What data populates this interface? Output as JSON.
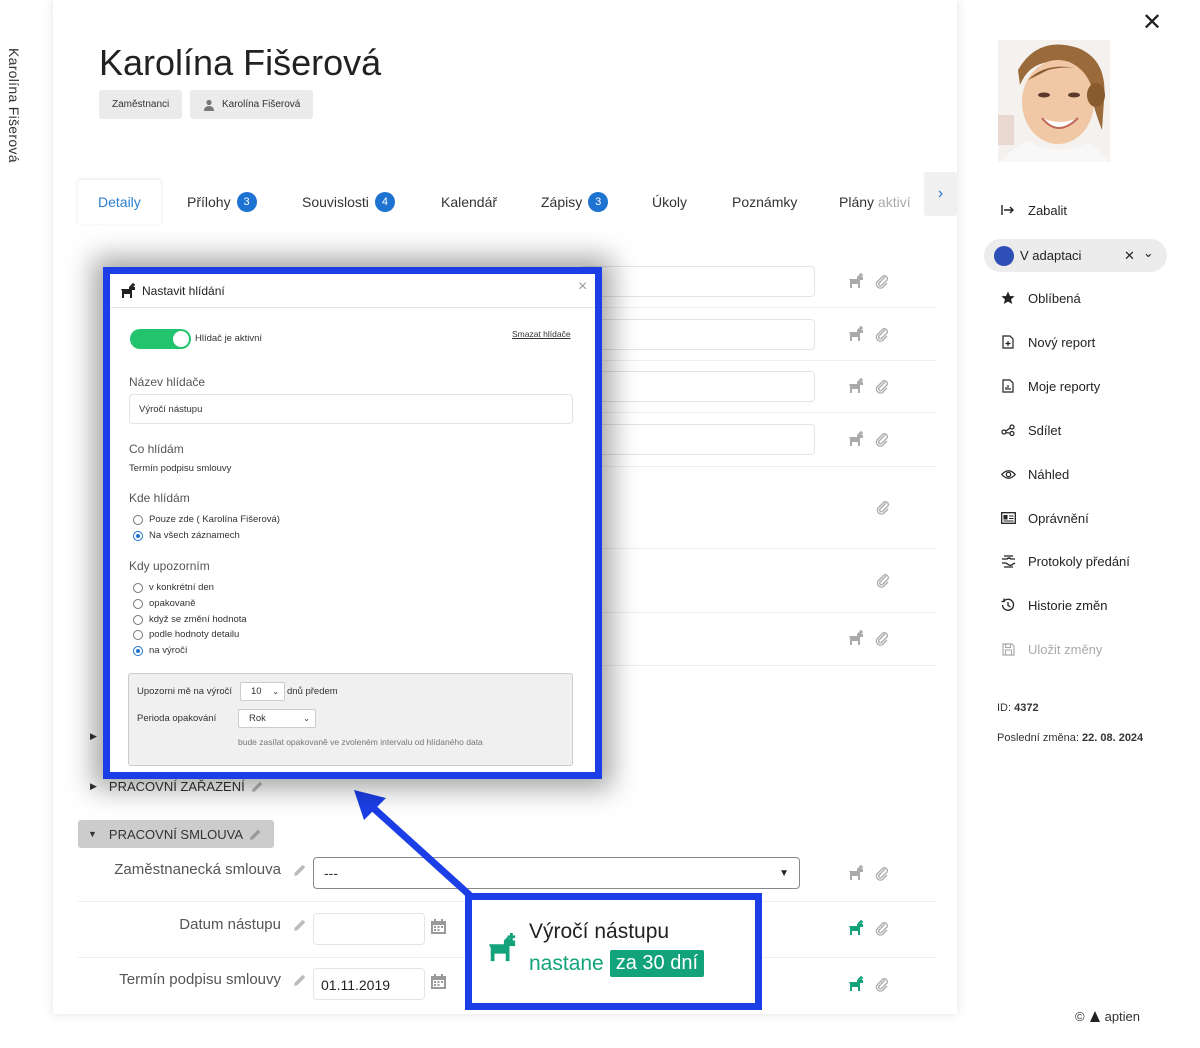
{
  "side_name": "Karolína Fišerová",
  "title": "Karolína Fišerová",
  "breadcrumbs": [
    "Zaměstnanci",
    "Karolína Fišerová"
  ],
  "tabs": [
    {
      "label": "Detaily",
      "badge": ""
    },
    {
      "label": "Přílohy",
      "badge": "3"
    },
    {
      "label": "Souvislosti",
      "badge": "4"
    },
    {
      "label": "Kalendář",
      "badge": ""
    },
    {
      "label": "Zápisy",
      "badge": "3"
    },
    {
      "label": "Úkoly",
      "badge": ""
    },
    {
      "label": "Poznámky",
      "badge": ""
    },
    {
      "label": "Plány",
      "label_fade": "aktiví",
      "badge": ""
    }
  ],
  "tab_next": "›",
  "sections": {
    "pracovni_zarazeni": "PRACOVNÍ ZAŘAZENÍ",
    "pracovni_smlouva": "PRACOVNÍ SMLOUVA"
  },
  "fields": {
    "smlouva_label": "Zaměstnanecká smlouva",
    "smlouva_value": "---",
    "nastup_label": "Datum nástupu",
    "nastup_value": "",
    "podpis_label": "Termín podpisu smlouvy",
    "podpis_value": "01.11.2019"
  },
  "modal": {
    "title": "Nastavit hlídání",
    "close": "×",
    "toggle_label": "Hlídač je aktivní",
    "toggle_on": true,
    "delete_link": "Smazat hlídače",
    "name_label": "Název hlídače",
    "name_value": "Výročí nástupu",
    "what_label": "Co hlídám",
    "what_value": "Termín podpisu smlouvy",
    "where_label": "Kde hlídám",
    "where_options": [
      {
        "label": "Pouze zde ( Karolína Fišerová)",
        "checked": false
      },
      {
        "label": "Na všech záznamech",
        "checked": true
      }
    ],
    "when_label": "Kdy upozorním",
    "when_options": [
      {
        "label": "v konkrétní den",
        "checked": false
      },
      {
        "label": "opakovaně",
        "checked": false
      },
      {
        "label": "když se změní hodnota",
        "checked": false
      },
      {
        "label": "podle hodnoty detailu",
        "checked": false
      },
      {
        "label": "na výročí",
        "checked": true
      }
    ],
    "notify_prefix": "Upozorni mě na výročí",
    "notify_days": "10",
    "notify_suffix": "dnů předem",
    "period_label": "Perioda opakování",
    "period_value": "Rok",
    "period_note": "bude zasílat opakovaně ve zvoleném intervalu od hlídaného data"
  },
  "callout": {
    "title": "Výročí nástupu",
    "sub": "nastane",
    "badge": "za 30 dní"
  },
  "sidebar": {
    "close": "✕",
    "items": [
      {
        "label": "Zabalit",
        "icon": "collapse-arrow-icon"
      },
      {
        "label": "Oblíbená",
        "icon": "star-icon"
      },
      {
        "label": "Nový report",
        "icon": "new-report-icon"
      },
      {
        "label": "Moje reporty",
        "icon": "reports-icon"
      },
      {
        "label": "Sdílet",
        "icon": "share-icon"
      },
      {
        "label": "Náhled",
        "icon": "eye-icon"
      },
      {
        "label": "Oprávnění",
        "icon": "id-card-icon"
      },
      {
        "label": "Protokoly předání",
        "icon": "handover-icon"
      },
      {
        "label": "Historie změn",
        "icon": "history-icon"
      },
      {
        "label": "Uložit změny",
        "icon": "save-icon"
      }
    ],
    "status": "V adaptaci",
    "status_clear": "✕",
    "status_chevron": "⌄",
    "id_label": "ID:",
    "id_value": "4372",
    "changed_label": "Poslední změna:",
    "changed_value": "22. 08. 2024"
  },
  "footer": {
    "copyright": "©",
    "brand": "aptien"
  },
  "colors": {
    "accent_blue": "#1e73d2",
    "highlight_border": "#1b3ee6",
    "toggle_green": "#22c36d",
    "watch_green": "#12a37a",
    "status_dot": "#2e4fb5"
  }
}
